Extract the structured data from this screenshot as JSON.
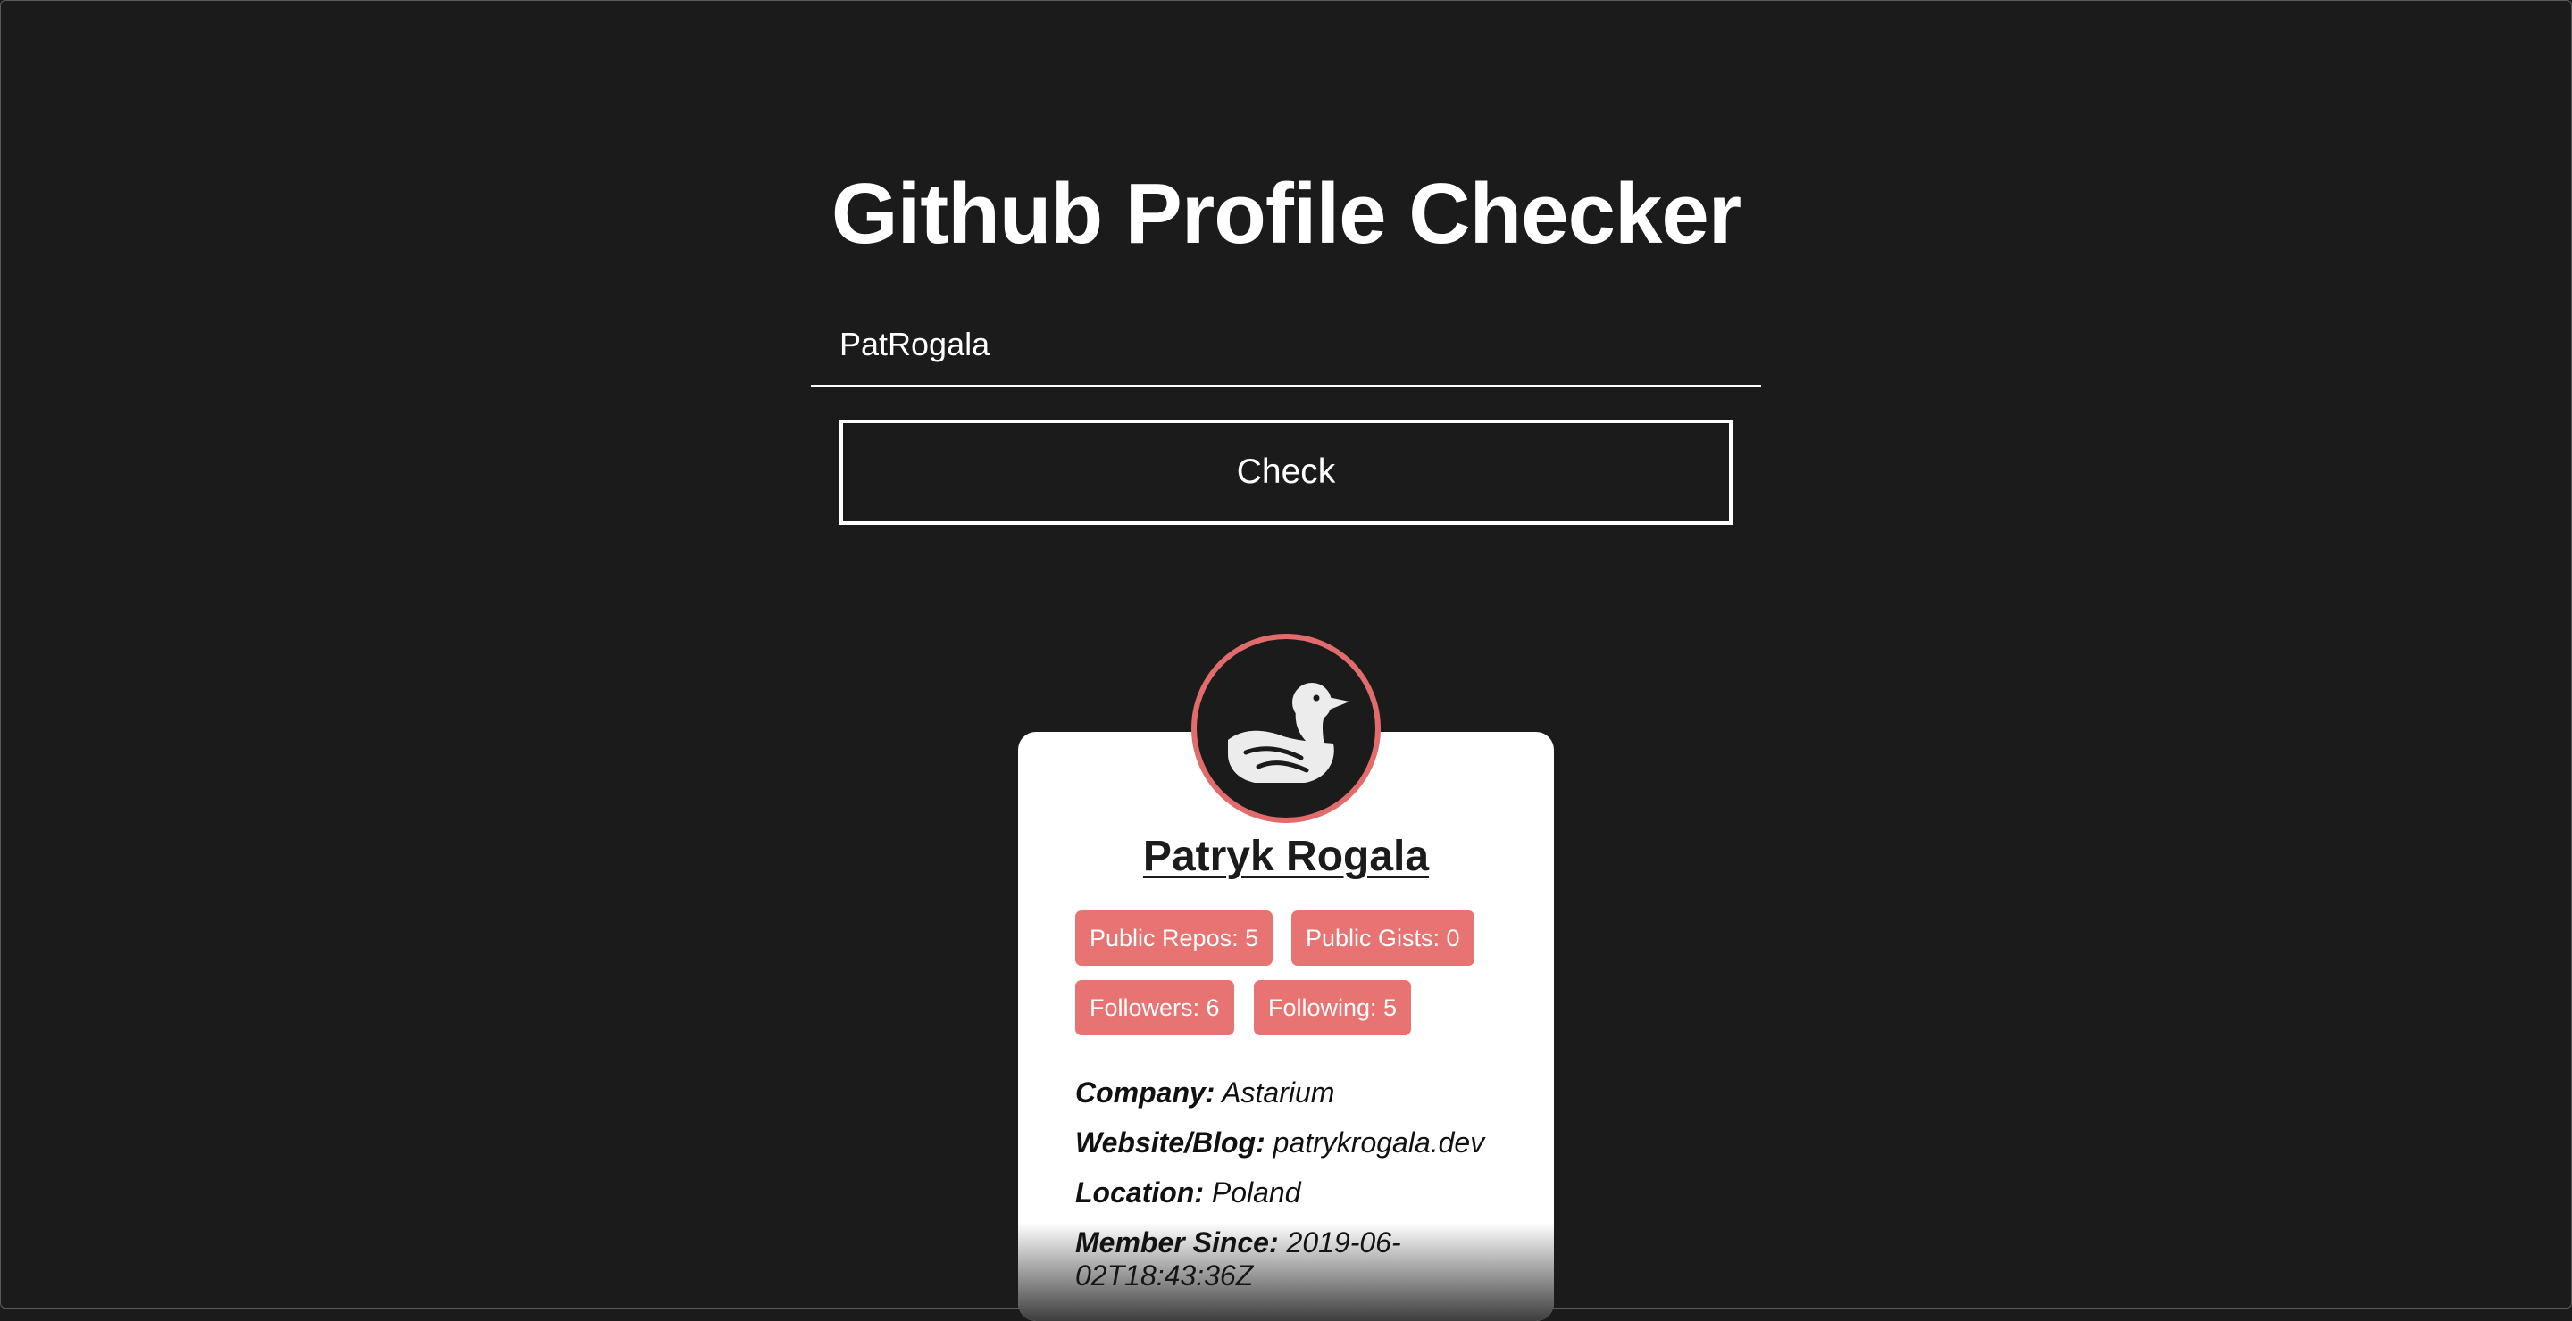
{
  "header": {
    "title": "Github Profile Checker"
  },
  "search": {
    "value": "PatRogala",
    "button_label": "Check"
  },
  "profile": {
    "avatar_icon": "duck-icon",
    "name": "Patryk Rogala",
    "stats": {
      "public_repos": "Public Repos: 5",
      "public_gists": "Public Gists: 0",
      "followers": "Followers: 6",
      "following": "Following: 5"
    },
    "details": {
      "company_label": "Company:",
      "company_value": "Astarium",
      "website_label": "Website/Blog:",
      "website_value": "patrykrogala.dev",
      "location_label": "Location:",
      "location_value": "Poland",
      "member_since_label": "Member Since:",
      "member_since_value": "2019-06-02T18:43:36Z"
    }
  },
  "colors": {
    "background": "#1b1b1b",
    "accent": "#e87373",
    "avatar_ring": "#e26b6b",
    "card": "#ffffff"
  }
}
